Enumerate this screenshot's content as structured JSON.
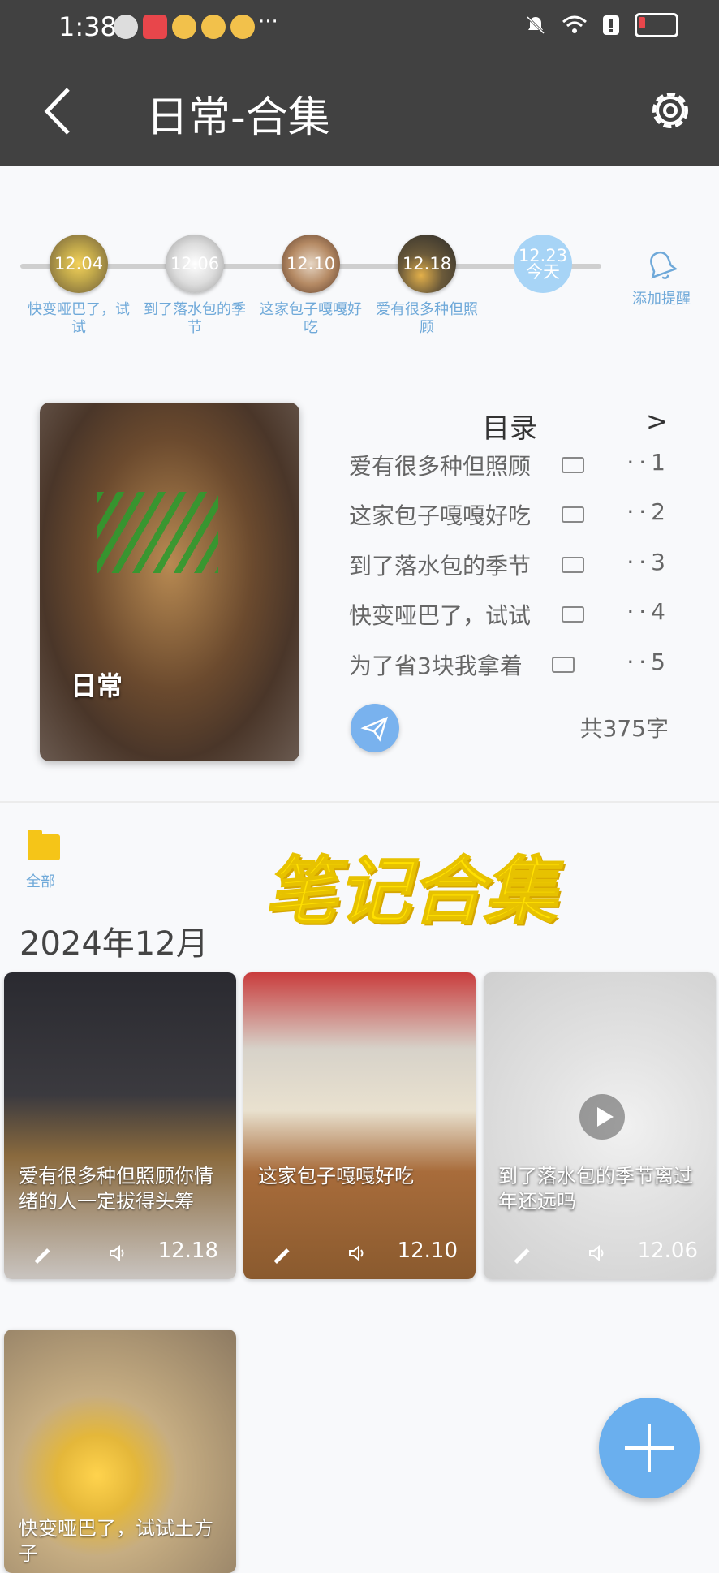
{
  "status_bar": {
    "time": "1:38",
    "more": "···"
  },
  "header": {
    "title": "日常-合集"
  },
  "timeline": {
    "nodes": [
      {
        "date": "12.04",
        "caption": "快变哑巴了，试试"
      },
      {
        "date": "12.06",
        "caption": "到了落水包的季节"
      },
      {
        "date": "12.10",
        "caption": "这家包子嘎嘎好吃"
      },
      {
        "date": "12.18",
        "caption": "爱有很多种但照顾"
      },
      {
        "date": "12.23",
        "caption": "今天"
      }
    ],
    "reminder_label": "添加提醒"
  },
  "catalog": {
    "cover_label": "日常",
    "toc_title": "目录",
    "toc_more": ">",
    "items": [
      {
        "title": "爱有很多种但照顾",
        "num": "··1"
      },
      {
        "title": "这家包子嘎嘎好吃",
        "num": "··2"
      },
      {
        "title": "到了落水包的季节",
        "num": "··3"
      },
      {
        "title": "快变哑巴了，试试",
        "num": "··4"
      },
      {
        "title": "为了省3块我拿着",
        "num": "··5"
      }
    ],
    "word_count": "共375字"
  },
  "notes": {
    "folder_label": "全部",
    "section_title": "笔记合集",
    "month": "2024年12月",
    "cards": [
      {
        "text": "爱有很多种但照顾你情绪的人一定拔得头筹",
        "date": "12.18"
      },
      {
        "text": "这家包子嘎嘎好吃",
        "date": "12.10"
      },
      {
        "text": "到了落水包的季节离过年还远吗",
        "date": "12.06"
      },
      {
        "text": "快变哑巴了，试试土方子"
      }
    ]
  },
  "colors": {
    "header_bg": "#414141",
    "accent": "#6aafee",
    "caption": "#6fa9d9",
    "title_yellow": "#ffe000"
  }
}
